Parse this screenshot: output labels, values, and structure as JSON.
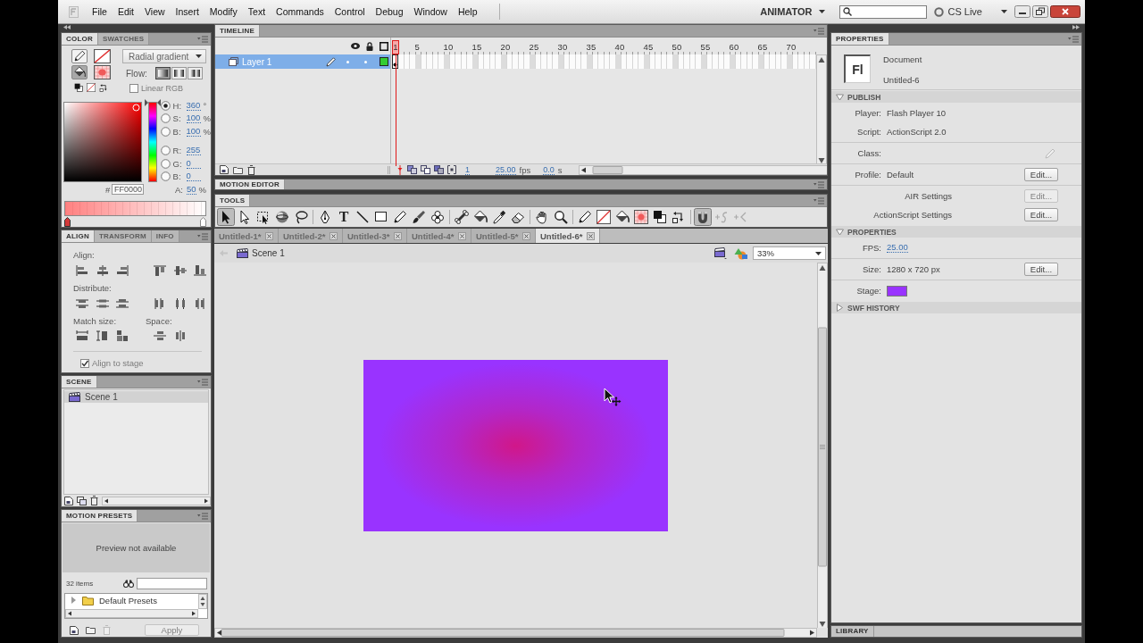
{
  "menubar": {
    "items": [
      "File",
      "Edit",
      "View",
      "Insert",
      "Modify",
      "Text",
      "Commands",
      "Control",
      "Debug",
      "Window",
      "Help"
    ],
    "workspace": "ANIMATOR",
    "cs_live": "CS Live"
  },
  "color_panel": {
    "tabs": [
      {
        "label": "COLOR",
        "selected": true
      },
      {
        "label": "SWATCHES",
        "selected": false
      }
    ],
    "targets": [
      {
        "kind": "stroke",
        "selected": false
      },
      {
        "kind": "fill",
        "selected": true
      }
    ],
    "fill_type": "Radial gradient",
    "flow": {
      "label": "Flow:",
      "options": [
        {
          "kind": "extend",
          "selected": true
        },
        {
          "kind": "reflect",
          "selected": false
        },
        {
          "kind": "repeat",
          "selected": false
        }
      ]
    },
    "linear_rgb": {
      "label": "Linear RGB",
      "checked": false
    },
    "hue": {
      "level": 1
    },
    "channel_groups": [
      [
        {
          "label": "H:",
          "value": "360",
          "unit": "°",
          "selected": true
        },
        {
          "label": "S:",
          "value": "100",
          "unit": "%",
          "selected": false
        },
        {
          "label": "B:",
          "value": "100",
          "unit": "%",
          "selected": false
        }
      ],
      [
        {
          "label": "R:",
          "value": "255",
          "selected": false
        },
        {
          "label": "G:",
          "value": "0",
          "selected": false
        },
        {
          "label": "B:",
          "value": "0",
          "selected": false
        }
      ]
    ],
    "hex_label": "#",
    "hex": "FF0000",
    "alpha": {
      "label": "A:",
      "value": "50",
      "unit": "%"
    }
  },
  "align_panel": {
    "tabs": [
      {
        "label": "ALIGN",
        "selected": true
      },
      {
        "label": "TRANSFORM",
        "selected": false
      },
      {
        "label": "INFO",
        "selected": false
      }
    ],
    "align_label": "Align:",
    "distribute_label": "Distribute:",
    "match_label": "Match size:",
    "space_label": "Space:",
    "align_to_stage": {
      "label": "Align to stage",
      "checked": true
    }
  },
  "scene_panel": {
    "tabs": [
      {
        "label": "SCENE",
        "selected": true
      }
    ],
    "scenes": [
      {
        "label": "Scene 1",
        "selected": true
      }
    ]
  },
  "motion_presets": {
    "tabs": [
      {
        "label": "MOTION PRESETS",
        "selected": true
      }
    ],
    "preview": "Preview not available",
    "count": "32 items",
    "tree": [
      {
        "label": "Default Presets",
        "expanded": false
      }
    ],
    "apply": {
      "label": "Apply",
      "disabled": true
    }
  },
  "timeline": {
    "tabs": [
      {
        "label": "TIMELINE",
        "selected": true
      }
    ],
    "ruler": [
      {
        "label": "1",
        "selected": true
      },
      {
        "label": "5",
        "selected": false
      },
      {
        "label": "10",
        "selected": false
      },
      {
        "label": "15",
        "selected": false
      },
      {
        "label": "20",
        "selected": false
      },
      {
        "label": "25",
        "selected": false
      },
      {
        "label": "30",
        "selected": false
      },
      {
        "label": "35",
        "selected": false
      },
      {
        "label": "40",
        "selected": false
      },
      {
        "label": "45",
        "selected": false
      },
      {
        "label": "50",
        "selected": false
      },
      {
        "label": "55",
        "selected": false
      },
      {
        "label": "60",
        "selected": false
      },
      {
        "label": "65",
        "selected": false
      },
      {
        "label": "70",
        "selected": false
      }
    ],
    "layers": [
      {
        "name": "Layer 1",
        "selected": true,
        "color": "#33cc33"
      }
    ],
    "current_frame": "1",
    "fps": "25.00",
    "fps_unit": "fps",
    "elapsed": "0.0",
    "elapsed_unit": "s"
  },
  "motion_editor": {
    "tabs": [
      {
        "label": "MOTION EDITOR",
        "selected": true
      }
    ]
  },
  "tools": {
    "tabs": [
      {
        "label": "TOOLS",
        "selected": true
      }
    ],
    "groups": [
      [
        {
          "kind": "selection",
          "selected": true,
          "disabled": false
        },
        {
          "kind": "subselection",
          "selected": false,
          "disabled": false
        },
        {
          "kind": "free-transform",
          "selected": false,
          "disabled": false
        },
        {
          "kind": "rotate-3d",
          "selected": false,
          "disabled": false
        },
        {
          "kind": "lasso",
          "selected": false,
          "disabled": false
        }
      ],
      [
        {
          "kind": "pen",
          "selected": false,
          "disabled": false
        },
        {
          "kind": "text",
          "glyph": "T",
          "selected": false,
          "disabled": false
        },
        {
          "kind": "line",
          "selected": false,
          "disabled": false
        },
        {
          "kind": "rectangle",
          "selected": false,
          "disabled": false
        },
        {
          "kind": "pencil",
          "selected": false,
          "disabled": false
        },
        {
          "kind": "brush",
          "selected": false,
          "disabled": false
        },
        {
          "kind": "deco",
          "selected": false,
          "disabled": false
        }
      ],
      [
        {
          "kind": "bone",
          "selected": false,
          "disabled": false
        },
        {
          "kind": "bucket",
          "selected": false,
          "disabled": false
        },
        {
          "kind": "eyedropper",
          "selected": false,
          "disabled": false
        },
        {
          "kind": "eraser",
          "selected": false,
          "disabled": false
        }
      ],
      [
        {
          "kind": "hand",
          "selected": false,
          "disabled": false
        },
        {
          "kind": "zoom",
          "selected": false,
          "disabled": false
        }
      ],
      [
        {
          "kind": "stroke-pencil",
          "selected": false,
          "disabled": false
        },
        {
          "kind": "stroke-swatch",
          "selected": false,
          "disabled": false
        },
        {
          "kind": "fill-bucket",
          "selected": false,
          "disabled": false
        },
        {
          "kind": "fill-swatch",
          "selected": false,
          "disabled": false
        },
        {
          "kind": "black-white",
          "selected": false,
          "disabled": false
        },
        {
          "kind": "swap",
          "selected": false,
          "disabled": false
        }
      ],
      [
        {
          "kind": "snap",
          "selected": true,
          "disabled": false
        },
        {
          "kind": "smooth",
          "selected": false,
          "disabled": true
        },
        {
          "kind": "straighten",
          "selected": false,
          "disabled": true
        }
      ]
    ]
  },
  "documents": [
    {
      "label": "Untitled-1*",
      "selected": false
    },
    {
      "label": "Untitled-2*",
      "selected": false
    },
    {
      "label": "Untitled-3*",
      "selected": false
    },
    {
      "label": "Untitled-4*",
      "selected": false
    },
    {
      "label": "Untitled-5*",
      "selected": false
    },
    {
      "label": "Untitled-6*",
      "selected": true
    }
  ],
  "edit_bar": {
    "scene": "Scene 1",
    "zoom": "33%"
  },
  "properties": {
    "tabs": [
      {
        "label": "PROPERTIES",
        "selected": true
      }
    ],
    "doc_icon": "Fl",
    "kind_label": "Document",
    "name": "Untitled-6",
    "sections": [
      {
        "title": "PUBLISH",
        "expanded": true,
        "groups": [
          [
            {
              "kind": "pair",
              "label": "Player:",
              "value": "Flash Player 10"
            },
            {
              "kind": "pair",
              "label": "Script:",
              "value": "ActionScript 2.0"
            }
          ],
          [
            {
              "kind": "field",
              "label": "Class:"
            }
          ],
          [
            {
              "kind": "pair",
              "label": "Profile:",
              "value": "Default",
              "button": {
                "label": "Edit...",
                "disabled": false
              }
            }
          ],
          [
            {
              "kind": "setting",
              "label": "AIR Settings",
              "button": {
                "label": "Edit...",
                "disabled": true
              }
            },
            {
              "kind": "setting",
              "label": "ActionScript Settings",
              "button": {
                "label": "Edit...",
                "disabled": false
              }
            }
          ]
        ]
      },
      {
        "title": "PROPERTIES",
        "expanded": true,
        "groups": [
          [
            {
              "kind": "hot",
              "label": "FPS:",
              "value": "25.00"
            }
          ],
          [
            {
              "kind": "pair",
              "label": "Size:",
              "value": "1280 x 720 px",
              "button": {
                "label": "Edit...",
                "disabled": false
              }
            }
          ],
          [
            {
              "kind": "swatch",
              "label": "Stage:",
              "color": "#9933ff"
            }
          ]
        ]
      },
      {
        "title": "SWF HISTORY",
        "expanded": false
      }
    ]
  },
  "library": {
    "tabs": [
      {
        "label": "LIBRARY",
        "selected": true
      }
    ]
  }
}
